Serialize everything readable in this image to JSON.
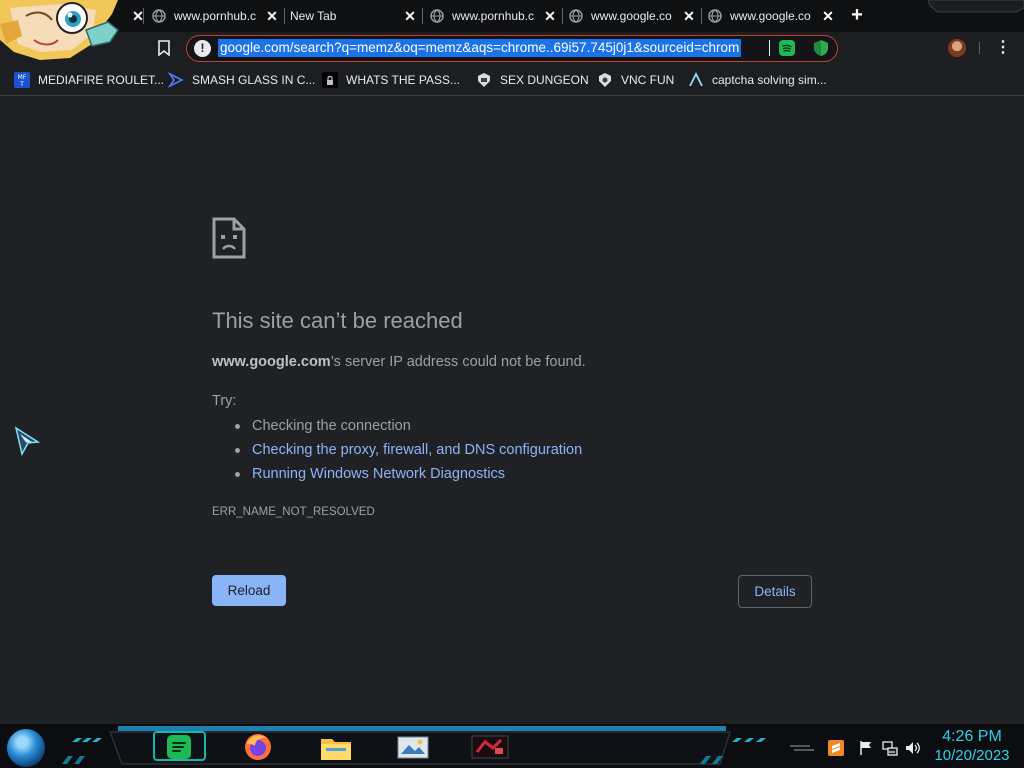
{
  "tabs": [
    {
      "title": "",
      "favicon": "mascot-avatar"
    },
    {
      "title": "www.pornhub.c",
      "favicon": "globe-icon"
    },
    {
      "title": "New Tab",
      "favicon": ""
    },
    {
      "title": "www.pornhub.c",
      "favicon": "globe-icon"
    },
    {
      "title": "www.google.co",
      "favicon": "globe-icon"
    },
    {
      "title": "www.google.co",
      "favicon": "globe-icon",
      "active": true
    }
  ],
  "new_tab_label": "+",
  "close_label": "✕",
  "omnibox": {
    "url": "google.com/search?q=memz&oq=memz&aqs=chrome..69i57.745j0j1&sourceid=chrom",
    "info_label": "!"
  },
  "menu_label": "⋮",
  "bookmarks": [
    {
      "label": "MEDIAFIRE ROULET...",
      "icon": "mediafire-icon"
    },
    {
      "label": "SMASH GLASS IN C...",
      "icon": "smash-icon"
    },
    {
      "label": "WHATS THE PASS...",
      "icon": "pass-icon"
    },
    {
      "label": "SEX DUNGEON",
      "icon": "dungeon-icon"
    },
    {
      "label": "VNC FUN",
      "icon": "vnc-icon"
    },
    {
      "label": "captcha solving sim...",
      "icon": "captcha-icon"
    }
  ],
  "error": {
    "title": "This site can’t be reached",
    "host": "www.google.com",
    "desc_suffix": "’s server IP address could not be found.",
    "try_label": "Try:",
    "suggestions": [
      "Checking the connection",
      "Checking the proxy, firewall, and DNS configuration",
      "Running Windows Network Diagnostics"
    ],
    "code": "ERR_NAME_NOT_RESOLVED",
    "reload_label": "Reload",
    "details_label": "Details"
  },
  "taskbar": {
    "apps": [
      "spotify-icon",
      "firefox-icon",
      "file-explorer-icon",
      "photos-icon",
      "game-app-icon"
    ],
    "tray": [
      "sublime-text-icon",
      "flag-icon",
      "network-icon",
      "volume-icon"
    ]
  },
  "clock": {
    "time": "4:26 PM",
    "date": "10/20/2023"
  },
  "colors": {
    "page_bg": "#202124",
    "text_secondary": "#9aa0a6",
    "link": "#8ab4f8",
    "url_selection": "#1a73e8",
    "omnibox_border": "#c5442b",
    "clock": "#2fd1e9",
    "spotify_green": "#1db954"
  }
}
